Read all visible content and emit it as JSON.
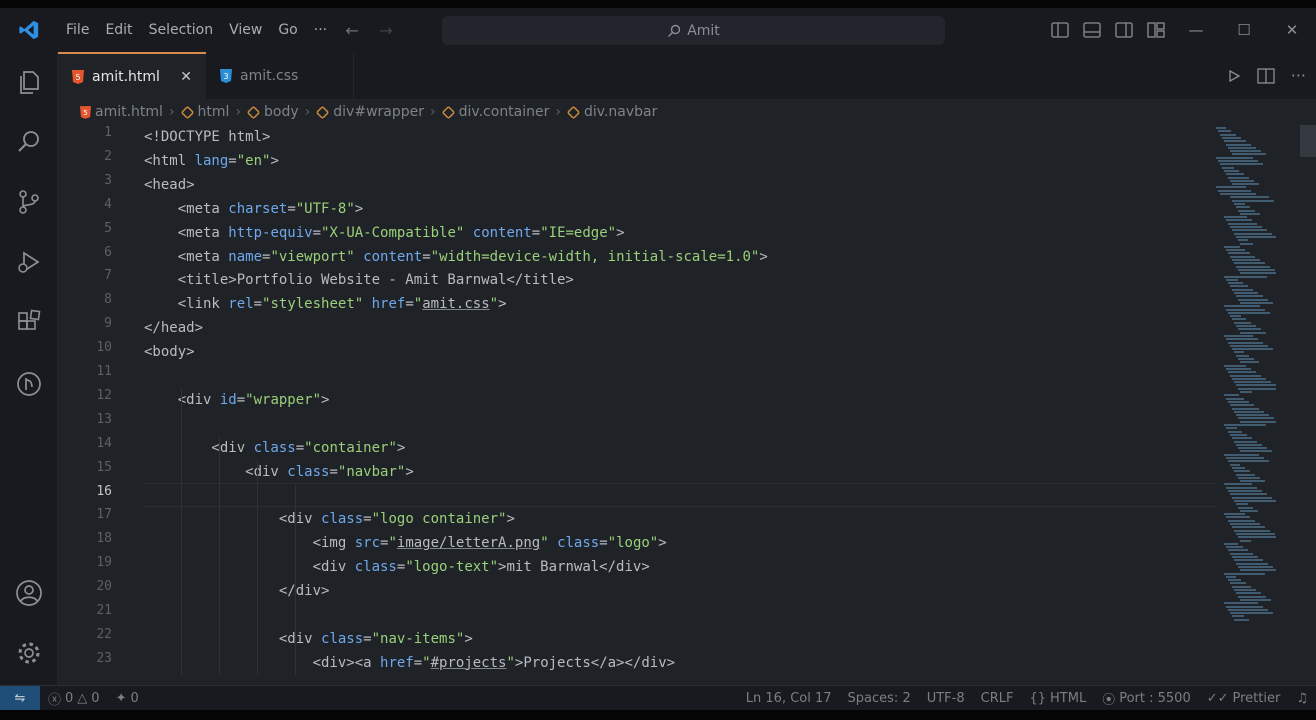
{
  "menu": [
    "File",
    "Edit",
    "Selection",
    "View",
    "Go",
    "···"
  ],
  "search": {
    "text": "Amit"
  },
  "tabs": [
    {
      "label": "amit.html",
      "icon": "html-file-icon",
      "close": "✕"
    },
    {
      "label": "amit.css",
      "icon": "css-file-icon"
    }
  ],
  "breadcrumb": [
    "amit.html",
    "html",
    "body",
    "div#wrapper",
    "div.container",
    "div.navbar"
  ],
  "line_numbers": [
    "1",
    "2",
    "3",
    "4",
    "5",
    "6",
    "7",
    "8",
    "9",
    "10",
    "11",
    "12",
    "13",
    "14",
    "15",
    "16",
    "17",
    "18",
    "19",
    "20",
    "21",
    "22",
    "23"
  ],
  "current_line": "16",
  "code": [
    [
      [
        "t",
        "<!DOCTYPE html>"
      ]
    ],
    [
      [
        "t",
        "<html "
      ],
      [
        "a",
        "lang"
      ],
      [
        "t",
        "="
      ],
      [
        "s",
        "\"en\""
      ],
      [
        "t",
        ">"
      ]
    ],
    [
      [
        "t",
        "<head>"
      ]
    ],
    [
      [
        "t",
        "    <meta "
      ],
      [
        "a",
        "charset"
      ],
      [
        "t",
        "="
      ],
      [
        "s",
        "\"UTF-8\""
      ],
      [
        "t",
        ">"
      ]
    ],
    [
      [
        "t",
        "    <meta "
      ],
      [
        "a",
        "http-equiv"
      ],
      [
        "t",
        "="
      ],
      [
        "s",
        "\"X-UA-Compatible\""
      ],
      [
        "t",
        " "
      ],
      [
        "a",
        "content"
      ],
      [
        "t",
        "="
      ],
      [
        "s",
        "\"IE=edge\""
      ],
      [
        "t",
        ">"
      ]
    ],
    [
      [
        "t",
        "    <meta "
      ],
      [
        "a",
        "name"
      ],
      [
        "t",
        "="
      ],
      [
        "s",
        "\"viewport\""
      ],
      [
        "t",
        " "
      ],
      [
        "a",
        "content"
      ],
      [
        "t",
        "="
      ],
      [
        "s",
        "\"width=device-width, initial-scale=1.0\""
      ],
      [
        "t",
        ">"
      ]
    ],
    [
      [
        "t",
        "    <title>Portfolio Website - Amit Barnwal</title>"
      ]
    ],
    [
      [
        "t",
        "    <link "
      ],
      [
        "a",
        "rel"
      ],
      [
        "t",
        "="
      ],
      [
        "s",
        "\"stylesheet\""
      ],
      [
        "t",
        " "
      ],
      [
        "a",
        "href"
      ],
      [
        "t",
        "="
      ],
      [
        "s",
        "\""
      ],
      [
        "l",
        "amit.css"
      ],
      [
        "s",
        "\""
      ],
      [
        "t",
        ">"
      ]
    ],
    [
      [
        "t",
        "</head>"
      ]
    ],
    [
      [
        "t",
        "<body>"
      ]
    ],
    [],
    [
      [
        "t",
        "    <div "
      ],
      [
        "a",
        "id"
      ],
      [
        "t",
        "="
      ],
      [
        "s",
        "\"wrapper\""
      ],
      [
        "t",
        ">"
      ]
    ],
    [],
    [
      [
        "t",
        "        <div "
      ],
      [
        "a",
        "class"
      ],
      [
        "t",
        "="
      ],
      [
        "s",
        "\"container\""
      ],
      [
        "t",
        ">"
      ]
    ],
    [
      [
        "t",
        "            <div "
      ],
      [
        "a",
        "class"
      ],
      [
        "t",
        "="
      ],
      [
        "s",
        "\"navbar\""
      ],
      [
        "t",
        ">"
      ]
    ],
    [],
    [
      [
        "t",
        "                <div "
      ],
      [
        "a",
        "class"
      ],
      [
        "t",
        "="
      ],
      [
        "s",
        "\"logo container\""
      ],
      [
        "t",
        ">"
      ]
    ],
    [
      [
        "t",
        "                    <img "
      ],
      [
        "a",
        "src"
      ],
      [
        "t",
        "="
      ],
      [
        "s",
        "\""
      ],
      [
        "l",
        "image/letterA.png"
      ],
      [
        "s",
        "\""
      ],
      [
        "t",
        " "
      ],
      [
        "a",
        "class"
      ],
      [
        "t",
        "="
      ],
      [
        "s",
        "\"logo\""
      ],
      [
        "t",
        ">"
      ]
    ],
    [
      [
        "t",
        "                    <div "
      ],
      [
        "a",
        "class"
      ],
      [
        "t",
        "="
      ],
      [
        "s",
        "\"logo-text\""
      ],
      [
        "t",
        ">mit Barnwal</div>"
      ]
    ],
    [
      [
        "t",
        "                </div>"
      ]
    ],
    [],
    [
      [
        "t",
        "                <div "
      ],
      [
        "a",
        "class"
      ],
      [
        "t",
        "="
      ],
      [
        "s",
        "\"nav-items\""
      ],
      [
        "t",
        ">"
      ]
    ],
    [
      [
        "t",
        "                    <div><a "
      ],
      [
        "a",
        "href"
      ],
      [
        "t",
        "="
      ],
      [
        "s",
        "\""
      ],
      [
        "l",
        "#projects"
      ],
      [
        "s",
        "\""
      ],
      [
        "t",
        ">Projects</a></div>"
      ]
    ]
  ],
  "status": {
    "errors": "0",
    "warnings": "0",
    "ports": "0",
    "position": "Ln 16, Col 17",
    "spaces": "Spaces: 2",
    "encoding": "UTF-8",
    "eol": "CRLF",
    "language": "HTML",
    "port": "Port : 5500",
    "formatter": "Prettier"
  },
  "colors": {
    "accent": "#d98b4b",
    "attribute": "#6fa8ea",
    "string": "#9ad07a",
    "tag": "#b8bcc2",
    "remote": "#1f4e79"
  }
}
